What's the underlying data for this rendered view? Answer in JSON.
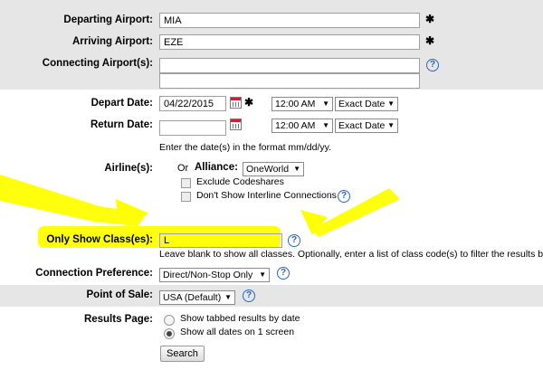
{
  "departing": {
    "label": "Departing Airport:",
    "value": "MIA",
    "required": "✱"
  },
  "arriving": {
    "label": "Arriving Airport:",
    "value": "EZE",
    "required": "✱"
  },
  "connecting": {
    "label": "Connecting Airport(s):",
    "value1": "",
    "value2": ""
  },
  "depart": {
    "label": "Depart Date:",
    "date": "04/22/2015",
    "required": "✱",
    "time": "12:00 AM",
    "precision": "Exact Date"
  },
  "return": {
    "label": "Return Date:",
    "date": "",
    "time": "12:00 AM",
    "precision": "Exact Date"
  },
  "date_hint": "Enter the date(s) in the format mm/dd/yy.",
  "airline": {
    "label": "Airline(s):",
    "or": "Or",
    "alliance_label": "Alliance:",
    "alliance_value": "OneWorld",
    "exclude_codeshares": "Exclude Codeshares",
    "exclude_codeshares_checked": false,
    "no_interline": "Don't Show Interline Connections",
    "no_interline_checked": false
  },
  "classes": {
    "label": "Only Show Class(es):",
    "value": "L",
    "hint": "Leave blank to show all classes. Optionally, enter a list of class code(s) to filter the results by."
  },
  "connection": {
    "label": "Connection Preference:",
    "value": "Direct/Non-Stop Only"
  },
  "pos": {
    "label": "Point of Sale:",
    "value": "USA (Default)"
  },
  "results": {
    "label": "Results Page:",
    "option1": "Show tabbed results by date",
    "option2": "Show all dates on 1 screen",
    "selected": "option2"
  },
  "search_label": "Search",
  "help_glyph": "?",
  "select_arrow": "▼",
  "colors": {
    "band": "#e6e6e6",
    "help": "#2a66c2",
    "highlight": "#ffff00"
  }
}
